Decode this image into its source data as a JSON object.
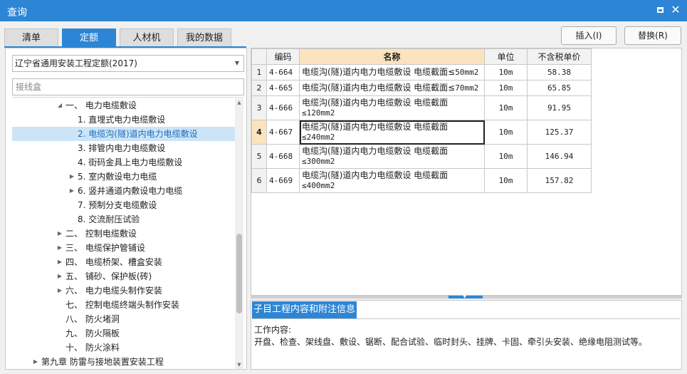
{
  "window": {
    "title": "查询"
  },
  "tabs": [
    {
      "label": "清单",
      "active": false
    },
    {
      "label": "定额",
      "active": true
    },
    {
      "label": "人材机",
      "active": false
    },
    {
      "label": "我的数据",
      "active": false
    }
  ],
  "buttons": {
    "insert": "插入(I)",
    "replace": "替换(R)"
  },
  "left": {
    "quota_library": "辽宁省通用安装工程定额(2017)",
    "search_placeholder": "接线盒",
    "tree": [
      {
        "label": "一、 电力电缆敷设",
        "expander": "expanded",
        "level": 4
      },
      {
        "label": "1. 直埋式电力电缆敷设",
        "expander": "none",
        "level": 5
      },
      {
        "label": "2. 电缆沟(隧)道内电力电缆敷设",
        "expander": "none",
        "level": 5,
        "selected": true
      },
      {
        "label": "3. 排管内电力电缆敷设",
        "expander": "none",
        "level": 5
      },
      {
        "label": "4. 街码金具上电力电缆敷设",
        "expander": "none",
        "level": 5
      },
      {
        "label": "5. 室内敷设电力电缆",
        "expander": "collapsed",
        "level": 5
      },
      {
        "label": "6. 竖井通道内敷设电力电缆",
        "expander": "collapsed",
        "level": 5
      },
      {
        "label": "7. 预制分支电缆敷设",
        "expander": "none",
        "level": 5
      },
      {
        "label": "8. 交流耐压试验",
        "expander": "none",
        "level": 5
      },
      {
        "label": "二、 控制电缆敷设",
        "expander": "collapsed",
        "level": 4
      },
      {
        "label": "三、 电缆保护管铺设",
        "expander": "collapsed",
        "level": 4
      },
      {
        "label": "四、 电缆桥架、槽盒安装",
        "expander": "collapsed",
        "level": 4
      },
      {
        "label": "五、 铺砂、保护板(砖)",
        "expander": "collapsed",
        "level": 4
      },
      {
        "label": "六、 电力电缆头制作安装",
        "expander": "collapsed",
        "level": 4
      },
      {
        "label": "七、 控制电缆终端头制作安装",
        "expander": "none",
        "level": 4
      },
      {
        "label": "八、 防火堵洞",
        "expander": "none",
        "level": 4
      },
      {
        "label": "九、 防火隔板",
        "expander": "none",
        "level": 4
      },
      {
        "label": "十、 防火涂料",
        "expander": "none",
        "level": 4
      },
      {
        "label": "第九章 防雷与接地装置安装工程",
        "expander": "collapsed",
        "level": 2
      }
    ]
  },
  "grid": {
    "columns": {
      "code": "编码",
      "name": "名称",
      "unit": "单位",
      "price": "不含税单价"
    },
    "rows": [
      {
        "num": "1",
        "code": "4-664",
        "name_a": "电缆沟(隧)道内电力电缆敷设 电缆截面≤",
        "name_b": "50mm2",
        "name_c": "",
        "unit": "10m",
        "price": "58.38"
      },
      {
        "num": "2",
        "code": "4-665",
        "name_a": "电缆沟(隧)道内电力电缆敷设 电缆截面≤",
        "name_b": "70mm2",
        "name_c": "",
        "unit": "10m",
        "price": "65.85"
      },
      {
        "num": "3",
        "code": "4-666",
        "name_a": "电缆沟(隧)道内电力电缆敷设 电缆截面",
        "name_b": "",
        "name_c": "≤120mm2",
        "unit": "10m",
        "price": "91.95"
      },
      {
        "num": "4",
        "code": "4-667",
        "name_a": "电缆沟(隧)道内电力电缆敷设 电缆截面",
        "name_b": "",
        "name_c": "≤240mm2",
        "unit": "10m",
        "price": "125.37",
        "current": true
      },
      {
        "num": "5",
        "code": "4-668",
        "name_a": "电缆沟(隧)道内电力电缆敷设 电缆截面",
        "name_b": "",
        "name_c": "≤300mm2",
        "unit": "10m",
        "price": "146.94"
      },
      {
        "num": "6",
        "code": "4-669",
        "name_a": "电缆沟(隧)道内电力电缆敷设 电缆截面",
        "name_b": "",
        "name_c": "≤400mm2",
        "unit": "10m",
        "price": "157.82"
      }
    ]
  },
  "detail": {
    "tab_label": "子目工程内容和附注信息",
    "work_label": "工作内容:",
    "work_text": "开盘、检查、架线盘、敷设、锯断、配合试验、临时封头、挂牌、卡固、牵引头安装、绝缘电阻测试等。"
  },
  "icons": {
    "maximize": "maximize-icon",
    "close": "close-icon",
    "dropdown": "chevron-down-icon",
    "expand": "triangle-right-icon",
    "collapse": "triangle-down-icon"
  },
  "colors": {
    "accent": "#2d86d5",
    "header_highlight": "#fbe3bd",
    "selection": "#cde4f7"
  }
}
